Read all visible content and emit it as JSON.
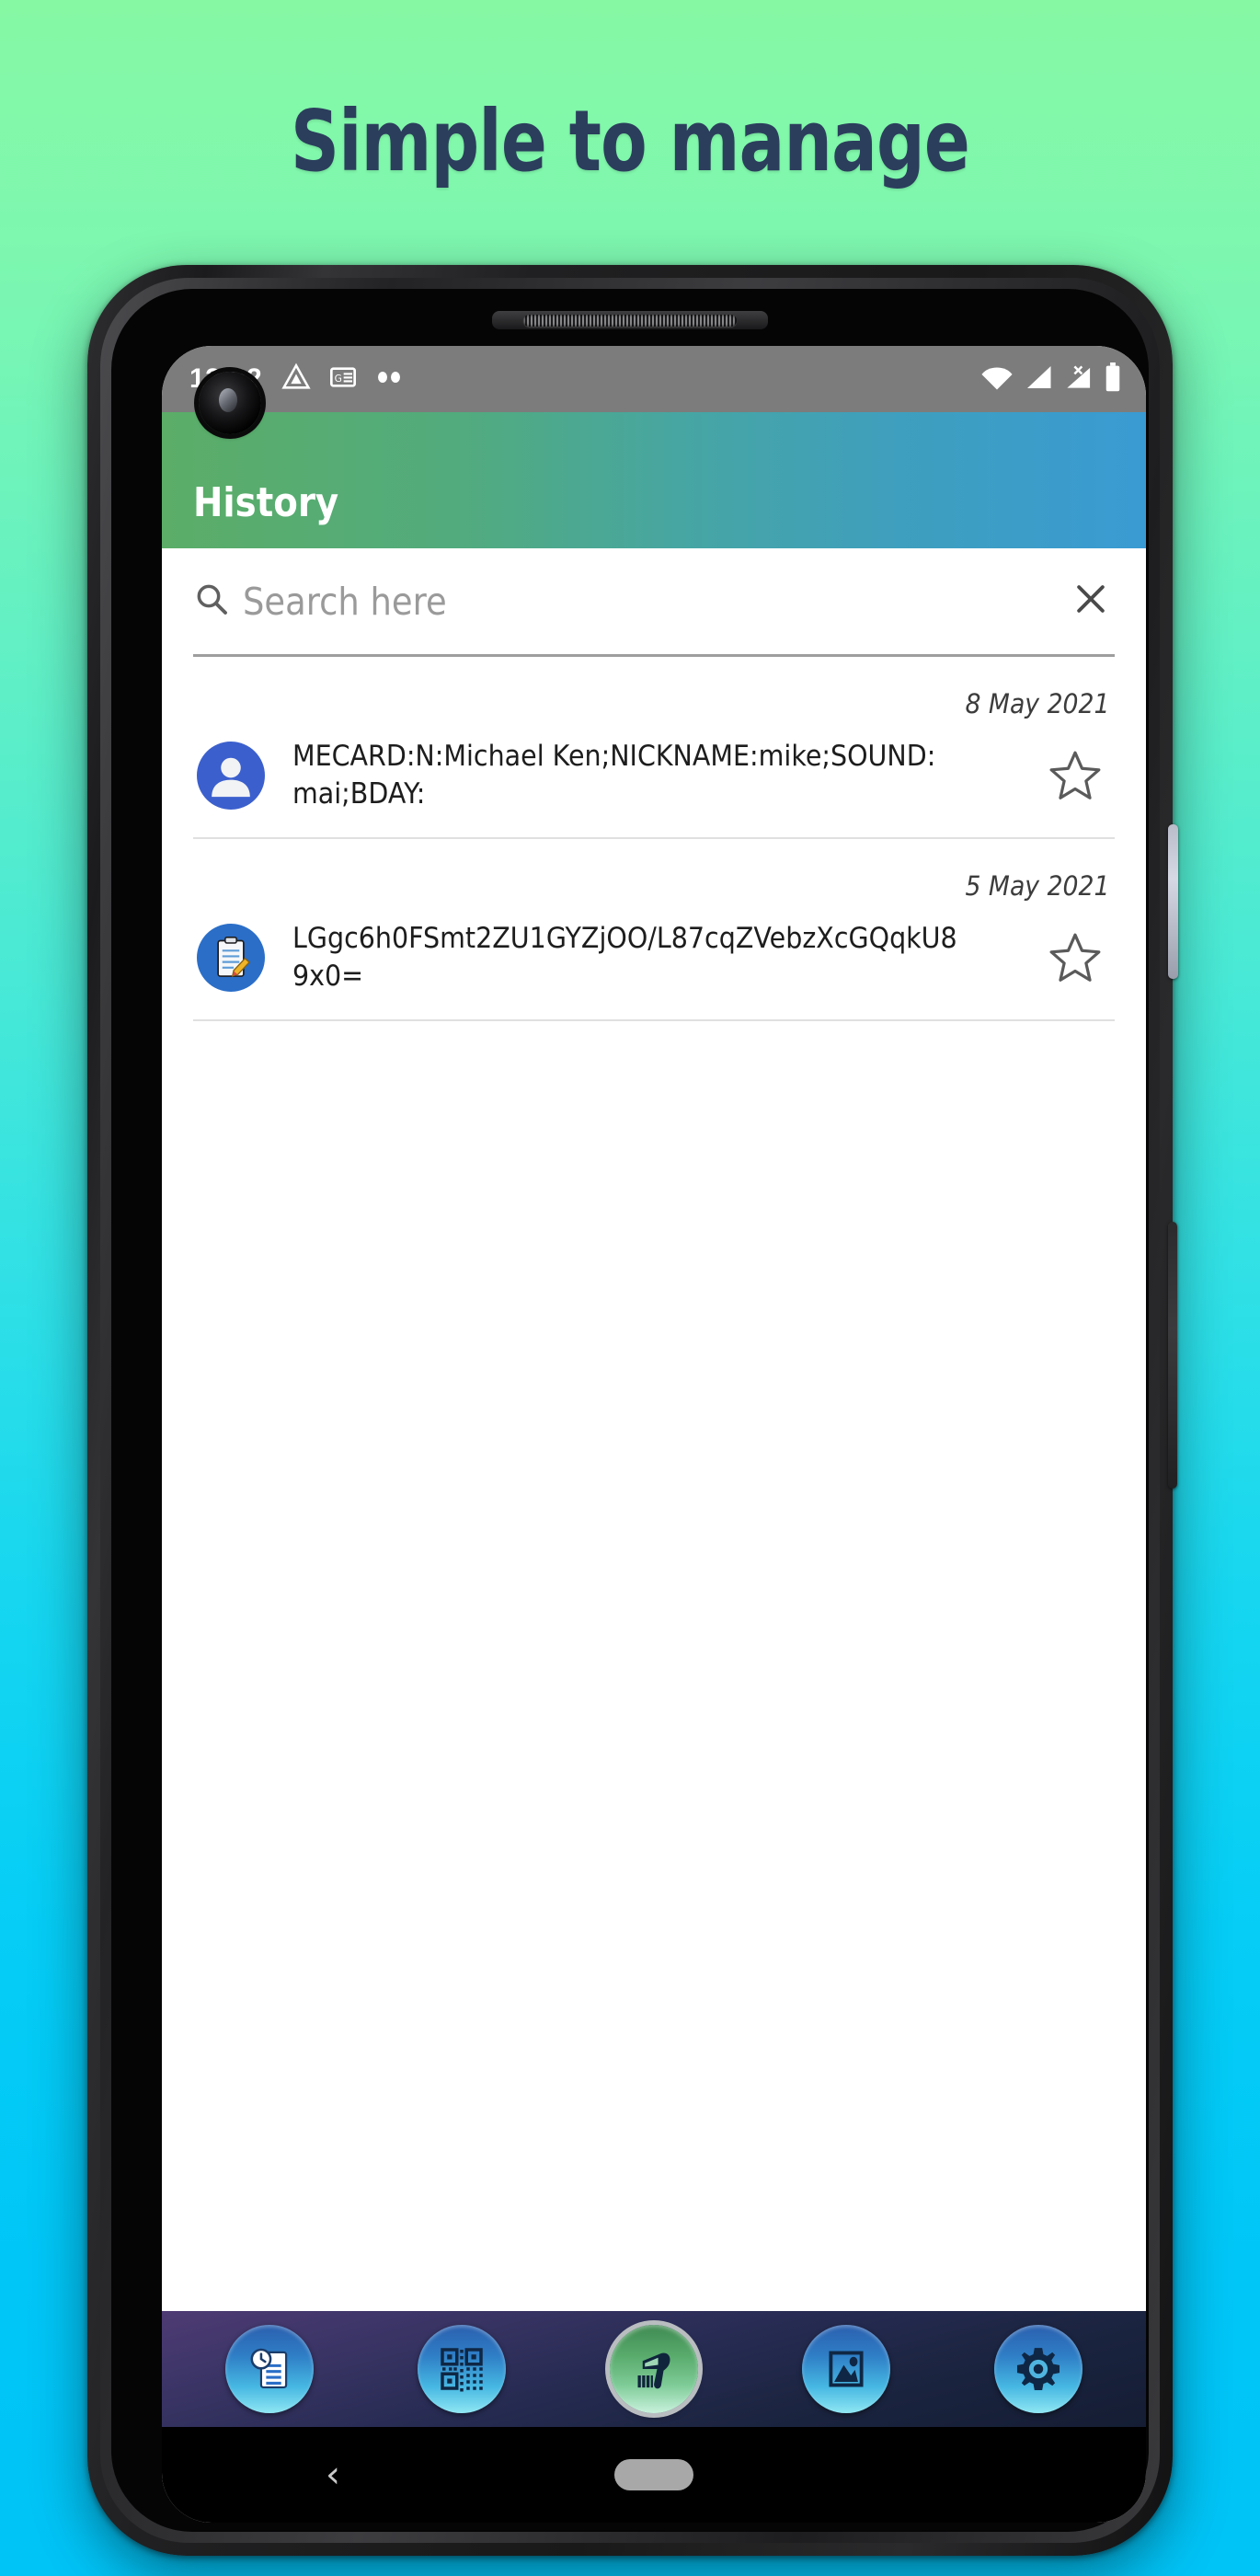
{
  "page": {
    "headline": "Simple to manage",
    "background_top_color": "#86f8a4",
    "background_bottom_color": "#00c3f6",
    "headline_color": "#2b3e5c"
  },
  "status_bar": {
    "time": "12:32",
    "left_icons": [
      "drive-triangle-icon",
      "news-card-icon",
      "more-dots-icon"
    ],
    "right_icons": [
      "wifi-icon",
      "signal-bars-icon",
      "signal-no-sim-icon",
      "battery-icon"
    ],
    "background_color": "#7c7c7c"
  },
  "app_bar": {
    "title": "History",
    "gradient_start": "#5bad67",
    "gradient_end": "#399bd3"
  },
  "search": {
    "placeholder": "Search here",
    "value": "",
    "clear_label": "×"
  },
  "history": {
    "items": [
      {
        "date": "8 May 2021",
        "icon": "contact-person-icon",
        "icon_color": "#3b5fcd",
        "text": "MECARD:N:Michael Ken;NICKNAME:mike;SOUND:mai;BDAY:",
        "starred": false
      },
      {
        "date": "5 May 2021",
        "icon": "clipboard-note-icon",
        "icon_color": "#2a6ec8",
        "text": "LGgc6h0FSmt2ZU1GYZjOO/L87cqZVebzXcGQqkU89x0=",
        "starred": false
      }
    ]
  },
  "bottom_nav": {
    "items": [
      {
        "name": "history-tab",
        "icon": "history-list-icon",
        "active": false
      },
      {
        "name": "qr-codes-tab",
        "icon": "qr-code-icon",
        "active": false
      },
      {
        "name": "scan-tab",
        "icon": "barcode-scanner-icon",
        "active": true
      },
      {
        "name": "gallery-tab",
        "icon": "image-gallery-icon",
        "active": false
      },
      {
        "name": "settings-tab",
        "icon": "gear-icon",
        "active": false
      }
    ],
    "gradient_start": "#4e3b74",
    "gradient_end": "#141d33"
  },
  "android_nav": {
    "back_label": "‹",
    "home_label": ""
  }
}
